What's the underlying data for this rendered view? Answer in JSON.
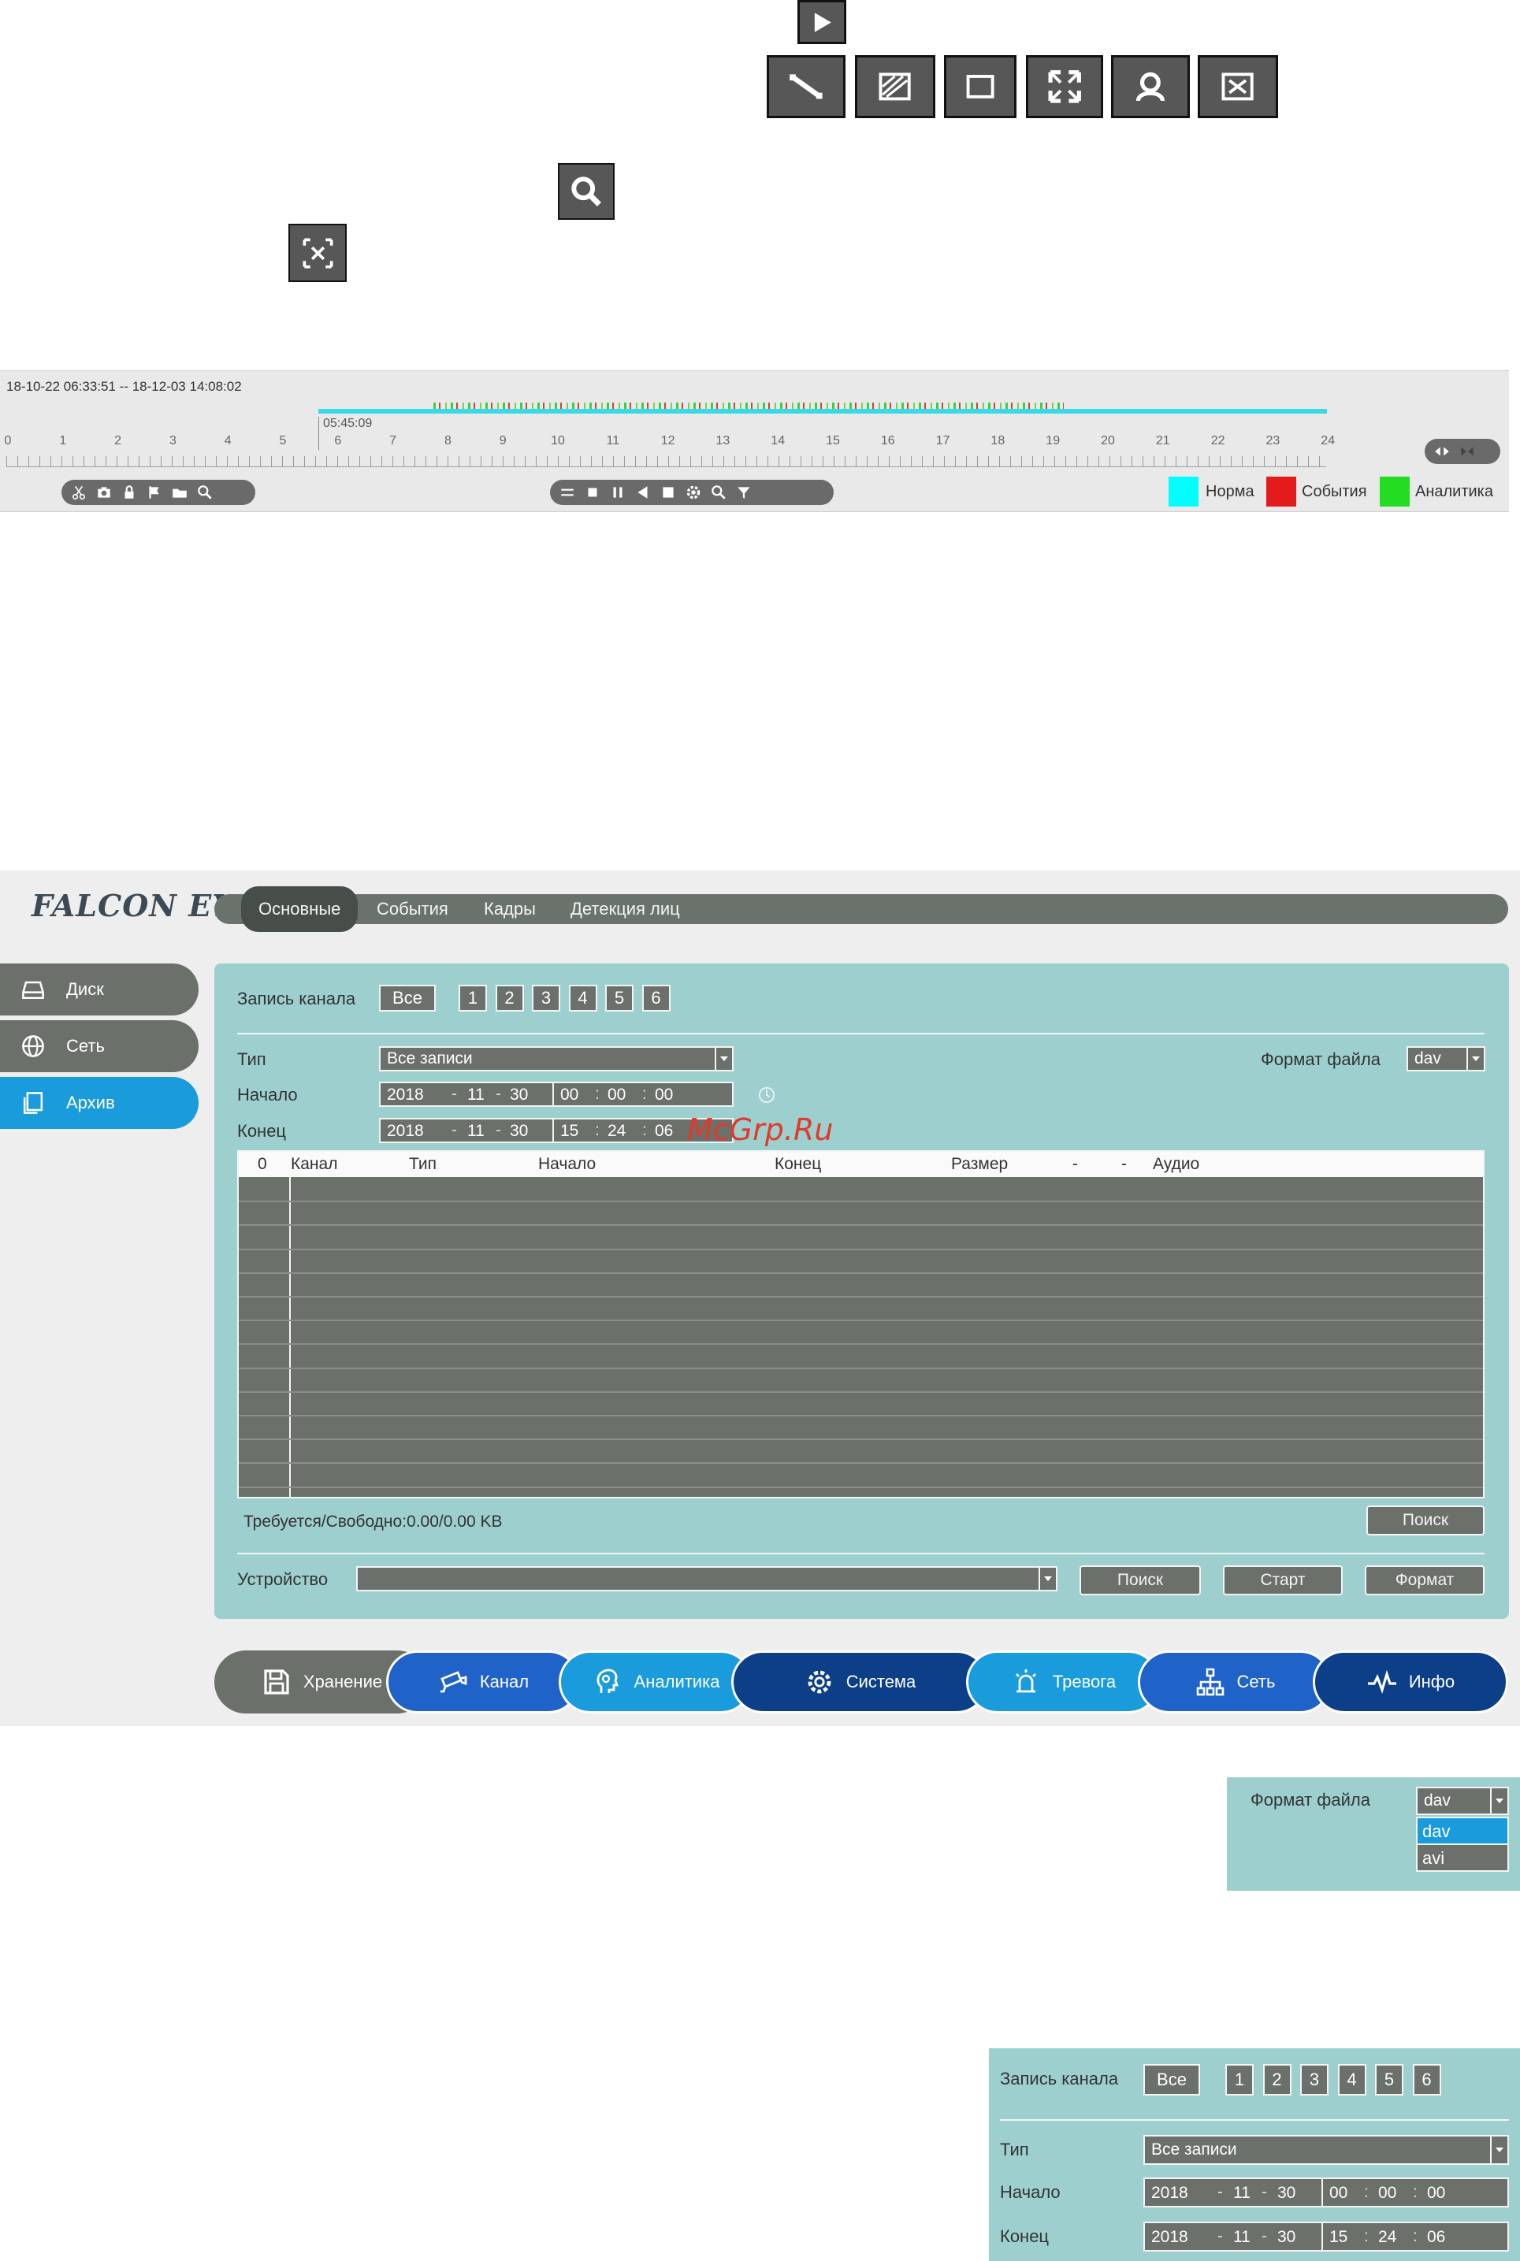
{
  "top_icons": {
    "play": "play-icon",
    "tools": [
      "line-icon",
      "mask-area-icon",
      "region-icon",
      "expand-icon",
      "person-icon",
      "clear-icon"
    ],
    "search": "search-icon",
    "clear": "clear-icon"
  },
  "timeline": {
    "range": "18-10-22 06:33:51 -- 18-12-03 14:08:02",
    "hours": [
      "0",
      "1",
      "2",
      "3",
      "4",
      "5",
      "6",
      "7",
      "8",
      "9",
      "10",
      "11",
      "12",
      "13",
      "14",
      "15",
      "16",
      "17",
      "18",
      "19",
      "20",
      "21",
      "22",
      "23",
      "24"
    ],
    "cursor_time": "05:45:09",
    "legend": [
      {
        "label": "Норма",
        "color": "#00ffff"
      },
      {
        "label": "События",
        "color": "#e31b1b"
      },
      {
        "label": "Аналитика",
        "color": "#22dd22"
      }
    ]
  },
  "app": {
    "logo": "FALCON EYE",
    "top_tabs": [
      "Основные",
      "События",
      "Кадры",
      "Детекция лиц"
    ],
    "sidebar": [
      {
        "label": "Диск",
        "icon": "disk-icon"
      },
      {
        "label": "Сеть",
        "icon": "globe-icon"
      },
      {
        "label": "Архив",
        "icon": "archive-icon"
      }
    ],
    "channel_label": "Запись канала",
    "channel_all": "Все",
    "channels": [
      "1",
      "2",
      "3",
      "4",
      "5",
      "6"
    ],
    "type_label": "Тип",
    "type_value": "Все записи",
    "format_label": "Формат файла",
    "format_value": "dav",
    "start_label": "Начало",
    "end_label": "Конец",
    "start": {
      "year": "2018",
      "month": "11",
      "day": "30",
      "h": "00",
      "m": "00",
      "s": "00"
    },
    "end": {
      "year": "2018",
      "month": "11",
      "day": "30",
      "h": "15",
      "m": "24",
      "s": "06"
    },
    "table_headers": [
      "0",
      "Канал",
      "Тип",
      "Начало",
      "Конец",
      "Размер",
      "-",
      "-",
      "Аудио"
    ],
    "storage_text": "Требуется/Свободно:0.00/0.00 KB",
    "search_button": "Поиск",
    "device_label": "Устройство",
    "device_search": "Поиск",
    "device_start": "Старт",
    "device_format": "Формат",
    "bottom_nav": [
      {
        "label": "Хранение",
        "icon": "save-icon",
        "color": "#6b706b"
      },
      {
        "label": "Канал",
        "icon": "camera-icon",
        "color": "#1f63c8"
      },
      {
        "label": "Аналитика",
        "icon": "head-icon",
        "color": "#1a9bdc"
      },
      {
        "label": "Система",
        "icon": "gear-icon",
        "color": "#0c3f87"
      },
      {
        "label": "Тревога",
        "icon": "alarm-icon",
        "color": "#1a9bdc"
      },
      {
        "label": "Сеть",
        "icon": "network-icon",
        "color": "#1f63c8"
      },
      {
        "label": "Инфо",
        "icon": "pulse-icon",
        "color": "#0c3f87"
      }
    ]
  },
  "watermark": "McGrp.Ru",
  "format_inset": {
    "label": "Формат файла",
    "value": "dav",
    "options": [
      "dav",
      "avi"
    ]
  },
  "channel_inset": {
    "channel_label": "Запись канала",
    "channel_all": "Все",
    "channels": [
      "1",
      "2",
      "3",
      "4",
      "5",
      "6"
    ],
    "type_label": "Тип",
    "type_value": "Все записи",
    "start_label": "Начало",
    "end_label": "Конец",
    "start": {
      "year": "2018",
      "month": "11",
      "day": "30",
      "h": "00",
      "m": "00",
      "s": "00"
    },
    "end": {
      "year": "2018",
      "month": "11",
      "day": "30",
      "h": "15",
      "m": "24",
      "s": "06"
    }
  }
}
